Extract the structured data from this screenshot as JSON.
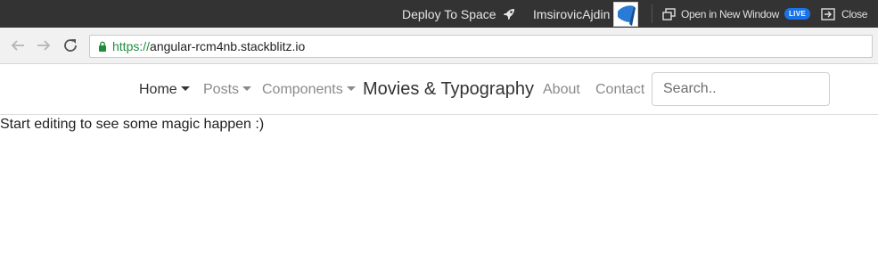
{
  "topbar": {
    "deploy_label": "Deploy To Space",
    "username": "ImsirovicAjdin",
    "open_window_label": "Open in New Window",
    "live_badge": "LIVE",
    "close_label": "Close"
  },
  "browser": {
    "url_scheme": "https://",
    "url_host": "angular-rcm4nb.stackblitz.io"
  },
  "nav": {
    "items": [
      {
        "label": "Home",
        "active": true,
        "dropdown": true
      },
      {
        "label": "Posts",
        "dropdown": true
      },
      {
        "label": "Components",
        "dropdown": true
      },
      {
        "label": "Movies & Typography"
      },
      {
        "label": "About"
      },
      {
        "label": "Contact"
      }
    ],
    "search_placeholder": "Search.."
  },
  "main": {
    "text": "Start editing to see some magic happen :)"
  },
  "colors": {
    "topbar_bg": "#333333",
    "live_badge": "#1a73e8",
    "secure_green": "#1e8e3e"
  }
}
